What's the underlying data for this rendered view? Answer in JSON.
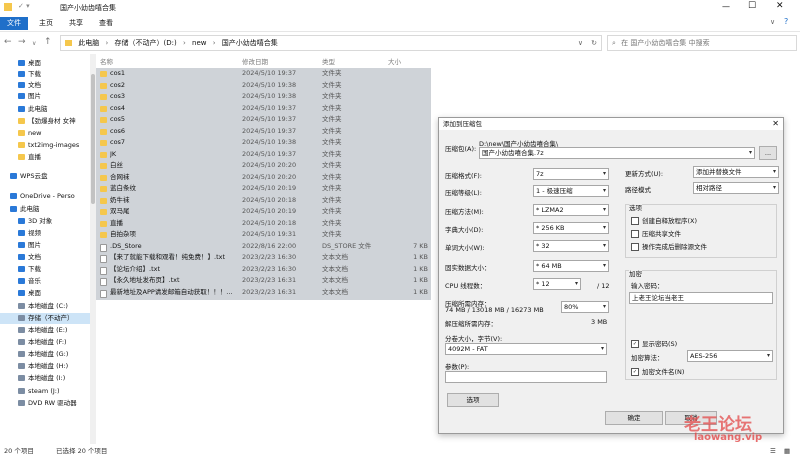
{
  "window": {
    "title": "国产小幼齿嘻合集"
  },
  "ribbon": {
    "tabs": [
      "文件",
      "主页",
      "共享",
      "查看"
    ]
  },
  "address": {
    "segments": [
      "此电脑",
      "存储（不动产）(D:)",
      "new",
      "国产小幼齿嘻合集"
    ],
    "search_placeholder": "在 国产小幼齿嘻合集 中搜索"
  },
  "nav": {
    "items": [
      {
        "label": "桌面",
        "icon": "blue"
      },
      {
        "label": "下载",
        "icon": "blue"
      },
      {
        "label": "文档",
        "icon": "blue"
      },
      {
        "label": "图片",
        "icon": "blue"
      },
      {
        "label": "此电脑",
        "icon": "blue"
      },
      {
        "label": "【劲爆身材 女神",
        "icon": "folder"
      },
      {
        "label": "new",
        "icon": "folder"
      },
      {
        "label": "txt2img-images",
        "icon": "folder"
      },
      {
        "label": "直播",
        "icon": "folder"
      },
      {
        "label": "WPS云盘",
        "icon": "blue"
      },
      {
        "label": "OneDrive - Perso",
        "icon": "blue"
      },
      {
        "label": "此电脑",
        "icon": "blue"
      },
      {
        "label": "3D 对象",
        "icon": "blue"
      },
      {
        "label": "视频",
        "icon": "blue"
      },
      {
        "label": "图片",
        "icon": "blue"
      },
      {
        "label": "文档",
        "icon": "blue"
      },
      {
        "label": "下载",
        "icon": "blue"
      },
      {
        "label": "音乐",
        "icon": "blue"
      },
      {
        "label": "桌面",
        "icon": "blue"
      },
      {
        "label": "本地磁盘 (C:)",
        "icon": "drive"
      },
      {
        "label": "存储（不动产）",
        "icon": "drive"
      },
      {
        "label": "本地磁盘 (E:)",
        "icon": "drive"
      },
      {
        "label": "本地磁盘 (F:)",
        "icon": "drive"
      },
      {
        "label": "本地磁盘 (G:)",
        "icon": "drive"
      },
      {
        "label": "本地磁盘 (H:)",
        "icon": "drive"
      },
      {
        "label": "本地磁盘 (I:)",
        "icon": "drive"
      },
      {
        "label": "steam (J:)",
        "icon": "drive"
      },
      {
        "label": "DVD RW 驱动器",
        "icon": "drive"
      }
    ]
  },
  "columns": {
    "name": "名称",
    "date": "修改日期",
    "type": "类型",
    "size": "大小"
  },
  "files": [
    {
      "name": "cos1",
      "date": "2024/5/10 19:37",
      "type": "文件夹",
      "size": "",
      "icon": "folder"
    },
    {
      "name": "cos2",
      "date": "2024/5/10 19:38",
      "type": "文件夹",
      "size": "",
      "icon": "folder"
    },
    {
      "name": "cos3",
      "date": "2024/5/10 19:38",
      "type": "文件夹",
      "size": "",
      "icon": "folder"
    },
    {
      "name": "cos4",
      "date": "2024/5/10 19:37",
      "type": "文件夹",
      "size": "",
      "icon": "folder"
    },
    {
      "name": "cos5",
      "date": "2024/5/10 19:37",
      "type": "文件夹",
      "size": "",
      "icon": "folder"
    },
    {
      "name": "cos6",
      "date": "2024/5/10 19:37",
      "type": "文件夹",
      "size": "",
      "icon": "folder"
    },
    {
      "name": "cos7",
      "date": "2024/5/10 19:38",
      "type": "文件夹",
      "size": "",
      "icon": "folder"
    },
    {
      "name": "JK",
      "date": "2024/5/10 19:37",
      "type": "文件夹",
      "size": "",
      "icon": "folder"
    },
    {
      "name": "白丝",
      "date": "2024/5/10 20:20",
      "type": "文件夹",
      "size": "",
      "icon": "folder"
    },
    {
      "name": "合网袜",
      "date": "2024/5/10 20:20",
      "type": "文件夹",
      "size": "",
      "icon": "folder"
    },
    {
      "name": "蓝白条纹",
      "date": "2024/5/10 20:19",
      "type": "文件夹",
      "size": "",
      "icon": "folder"
    },
    {
      "name": "奶牛袜",
      "date": "2024/5/10 20:18",
      "type": "文件夹",
      "size": "",
      "icon": "folder"
    },
    {
      "name": "双马尾",
      "date": "2024/5/10 20:19",
      "type": "文件夹",
      "size": "",
      "icon": "folder"
    },
    {
      "name": "直播",
      "date": "2024/5/10 20:18",
      "type": "文件夹",
      "size": "",
      "icon": "folder"
    },
    {
      "name": "自拍杂项",
      "date": "2024/5/10 19:31",
      "type": "文件夹",
      "size": "",
      "icon": "folder"
    },
    {
      "name": ".DS_Store",
      "date": "2022/8/16 22:00",
      "type": "DS_STORE 文件",
      "size": "7 KB",
      "icon": "file"
    },
    {
      "name": "【来了就能下载和观看！纯免费！】.txt",
      "date": "2023/2/23 16:30",
      "type": "文本文档",
      "size": "1 KB",
      "icon": "file"
    },
    {
      "name": "【论坛介绍】.txt",
      "date": "2023/2/23 16:30",
      "type": "文本文档",
      "size": "1 KB",
      "icon": "file"
    },
    {
      "name": "【永久地址发布页】.txt",
      "date": "2023/2/23 16:31",
      "type": "文本文档",
      "size": "1 KB",
      "icon": "file"
    },
    {
      "name": "最新地址及APP请发邮箱自动获取！！！...",
      "date": "2023/2/23 16:31",
      "type": "文本文档",
      "size": "1 KB",
      "icon": "file"
    }
  ],
  "status": {
    "count": "20 个项目",
    "selected": "已选择 20 个项目"
  },
  "dialog": {
    "title": "添加到压缩包",
    "archive_label": "压缩包(A):",
    "archive_path": "D:\\new\\国产小幼齿嘻合集\\",
    "archive_name": "国产小幼齿嘻合集.7z",
    "browse": "...",
    "fields": [
      {
        "label": "压缩格式(F):",
        "value": "7z"
      },
      {
        "label": "压缩等级(L):",
        "value": "1 - 极速压缩"
      },
      {
        "label": "压缩方法(M):",
        "value": "* LZMA2"
      },
      {
        "label": "字典大小(D):",
        "value": "* 256 KB"
      },
      {
        "label": "单词大小(W):",
        "value": "* 32"
      },
      {
        "label": "固实数据大小：",
        "value": "* 64 MB"
      },
      {
        "label": "CPU 线程数：",
        "value": "* 12"
      }
    ],
    "cpu_total": "/ 12",
    "mem_label": "压缩所需内存：",
    "mem_value": "74 MB / 13018 MB / 16273 MB",
    "mem_percent": "80%",
    "decomp_label": "解压缩所需内存：",
    "decomp_value": "3 MB",
    "split_label": "分卷大小，字节(V):",
    "split_value": "4092M - FAT",
    "params_label": "参数(P):",
    "options_button": "选项",
    "update_label": "更新方式(U):",
    "update_value": "添加并替换文件",
    "path_label": "路径模式",
    "path_value": "相对路径",
    "options_title": "选项",
    "options": [
      "创建自释放程序(X)",
      "压缩共享文件",
      "操作完成后删除源文件"
    ],
    "enc_title": "加密",
    "pwd_label": "输入密码：",
    "pwd_value": "上老王论坛当老王",
    "show_pwd": "显示密码(S)",
    "enc_method_label": "加密算法：",
    "enc_method": "AES-256",
    "enc_names": "加密文件名(N)",
    "ok": "确定",
    "cancel": "取消"
  },
  "watermark": {
    "title": "老王论坛",
    "url": "laowang.vip"
  }
}
